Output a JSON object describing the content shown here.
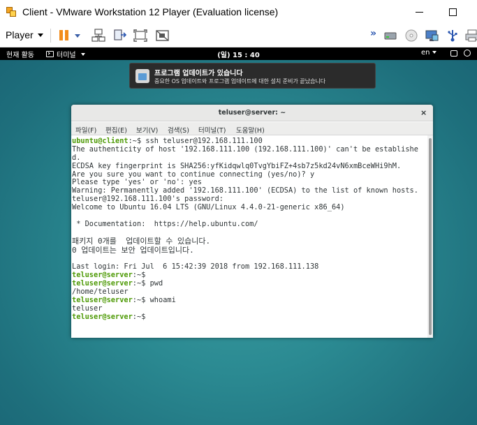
{
  "window": {
    "title": "Client - VMware Workstation 12 Player (Evaluation license)"
  },
  "toolbar": {
    "player_label": "Player",
    "icons": [
      "pause-icon",
      "network-icon",
      "send-ctrl-alt-del-icon",
      "fullscreen-icon",
      "unity-icon",
      "forward-icon",
      "hdd-icon",
      "cd-icon",
      "display-icon",
      "usb-icon",
      "printer-icon"
    ]
  },
  "gnome": {
    "activities": "현재 활동",
    "terminal_app": "터미널",
    "clock": "(일) 15 : 40",
    "lang": "en"
  },
  "notification": {
    "title": "프로그램 업데이트가 있습니다",
    "body": "중요한 OS 업데이트와 프로그램 업데이트에 대한 설치 준비가 끝났습니다"
  },
  "terminal": {
    "title": "teluser@server: ~",
    "close": "×",
    "menu": [
      "파일(F)",
      "편집(E)",
      "보기(V)",
      "검색(S)",
      "터미널(T)",
      "도움말(H)"
    ],
    "lines": [
      {
        "user": "ubuntu@client",
        "path": ":~$",
        "text": " ssh teluser@192.168.111.100"
      },
      {
        "text": "The authenticity of host '192.168.111.100 (192.168.111.100)' can't be establishe"
      },
      {
        "text": "d."
      },
      {
        "text": "ECDSA key fingerprint is SHA256:yfKidqwlq0TvgYbiFZ+4sb7z5kd24vN6xmBceWHi9hM."
      },
      {
        "text": "Are you sure you want to continue connecting (yes/no)? y"
      },
      {
        "text": "Please type 'yes' or 'no': yes"
      },
      {
        "text": "Warning: Permanently added '192.168.111.100' (ECDSA) to the list of known hosts."
      },
      {
        "text": "teluser@192.168.111.100's password:"
      },
      {
        "text": "Welcome to Ubuntu 16.04 LTS (GNU/Linux 4.4.0-21-generic x86_64)"
      },
      {
        "text": ""
      },
      {
        "text": " * Documentation:  https://help.ubuntu.com/"
      },
      {
        "text": ""
      },
      {
        "text": "패키지 0개를  업데이트할 수 있습니다.",
        "kr": true
      },
      {
        "text": "0 업데이트는 보안 업데이트입니다.",
        "kr": true
      },
      {
        "text": ""
      },
      {
        "text": "Last login: Fri Jul  6 15:42:39 2018 from 192.168.111.138"
      },
      {
        "user": "teluser@server",
        "path": ":~$",
        "text": ""
      },
      {
        "user": "teluser@server",
        "path": ":~$",
        "text": " pwd"
      },
      {
        "text": "/home/teluser"
      },
      {
        "user": "teluser@server",
        "path": ":~$",
        "text": " whoami"
      },
      {
        "text": "teluser"
      },
      {
        "user": "teluser@server",
        "path": ":~$",
        "text": ""
      }
    ]
  }
}
